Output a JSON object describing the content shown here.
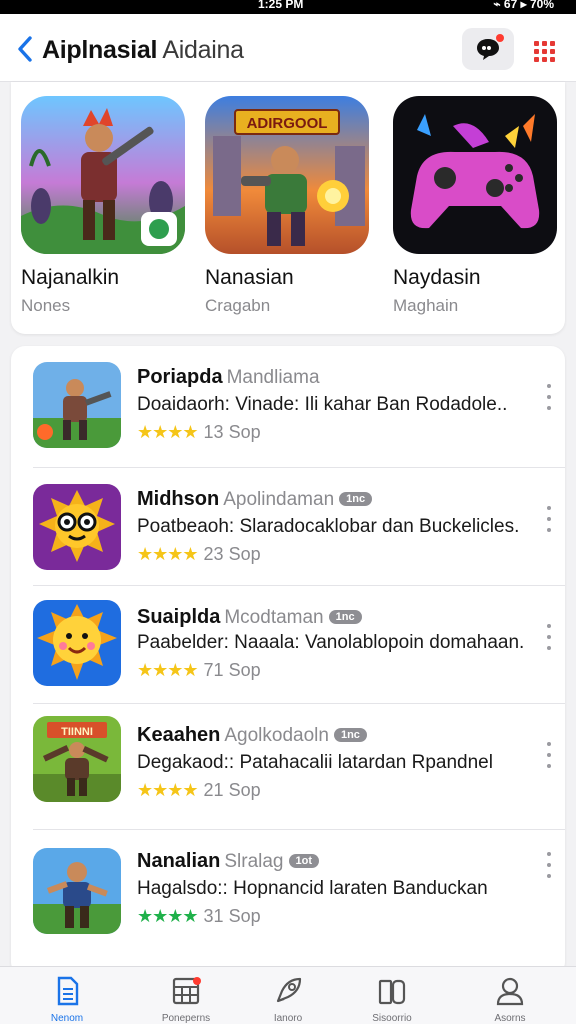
{
  "status_bar": {
    "time": "1:25 PM",
    "right": "⌁ 67 ▸ 70%"
  },
  "header": {
    "title_strong": "Aiplnasial",
    "title_light": "Aidaina",
    "back_icon": "chevron-left-icon",
    "chat_icon": "chat-bubble-icon",
    "menu_icon": "grid-dots-icon",
    "accent": "#1a73e8",
    "badge_color": "#ff3b30"
  },
  "featured": [
    {
      "name": "Najanalkin",
      "sub": "Nones",
      "icon": "warrior-game-icon"
    },
    {
      "name": "Nanasian",
      "sub": "Cragabn",
      "banner": "ADIRGOOL",
      "icon": "action-hero-game-icon"
    },
    {
      "name": "Naydasin",
      "sub": "Maghain",
      "icon": "gamepad-icon"
    }
  ],
  "apps": [
    {
      "name": "Poriapda",
      "developer": "Mandliama",
      "badge": "",
      "description": "Doaidaorh: Vinade: Ili kahar Ban Rodadole..",
      "stars": "★★★★",
      "count": "13 Sop",
      "star_color": "#f5c518",
      "icon": "warrior-icon"
    },
    {
      "name": "Midhson",
      "developer": "Apolindaman",
      "badge": "1nc",
      "description": "Poatbeaoh: Slaradocaklobar dan Buckelicles.",
      "stars": "★★★★",
      "count": "23 Sop",
      "star_color": "#f5c518",
      "icon": "sun-glasses-icon"
    },
    {
      "name": "Suaiplda",
      "developer": "Mcodtaman",
      "badge": "1nc",
      "description": "Paabelder: Naaala: Vanolablopoin domahaan.",
      "stars": "★★★★",
      "count": "71 Sop",
      "star_color": "#f5c518",
      "icon": "sun-face-icon"
    },
    {
      "name": "Keaahen",
      "developer": "Agolkodaoln",
      "badge": "1nc",
      "description": "Degakaod:: Patahacalii latardan Rpandnel",
      "stars": "★★★★",
      "count": "21 Sop",
      "star_color": "#f5c518",
      "icon": "soldier-icon",
      "banner": "TIINNI"
    },
    {
      "name": "Nanalian",
      "developer": "Slralag",
      "badge": "1ot",
      "description": "Hagalsdo:: Hopnancid laraten Banduckan",
      "stars": "★★★★",
      "count": "31 Sop",
      "star_color": "#1fb14a",
      "icon": "hero-icon"
    }
  ],
  "tabs": [
    {
      "label": "Nenom",
      "icon": "document-icon",
      "active": true
    },
    {
      "label": "Poneperns",
      "icon": "calendar-grid-icon",
      "active": false,
      "badge": true
    },
    {
      "label": "Ianoro",
      "icon": "rocket-icon",
      "active": false
    },
    {
      "label": "Sisoorrio",
      "icon": "book-icon",
      "active": false
    },
    {
      "label": "Asorns",
      "icon": "profile-icon",
      "active": false
    }
  ]
}
